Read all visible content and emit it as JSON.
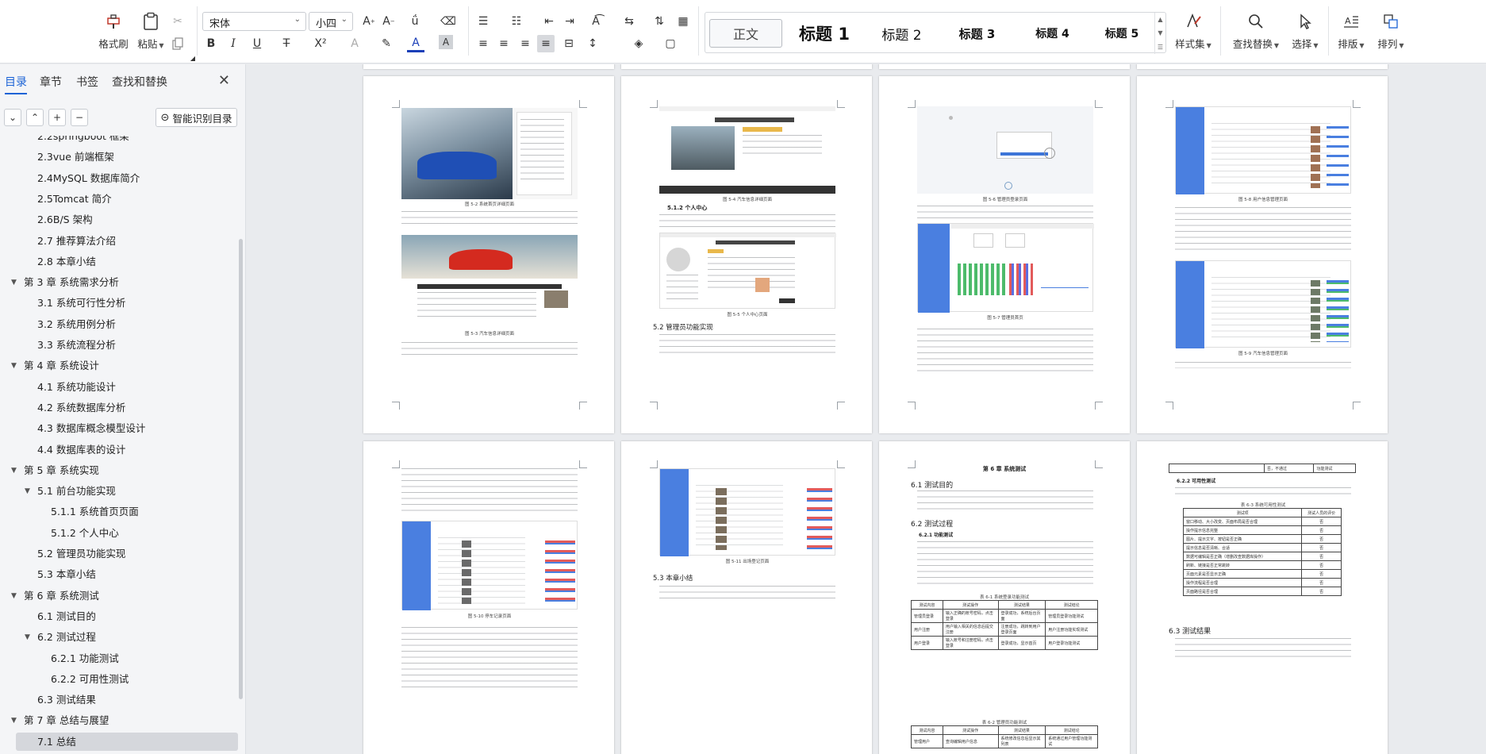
{
  "ribbon": {
    "format_brush": "格式刷",
    "paste": "粘贴",
    "font_name": "宋体",
    "font_size": "小四",
    "styles": {
      "normal": "正文",
      "h1": "标题 1",
      "h2": "标题 2",
      "h3": "标题 3",
      "h4": "标题 4",
      "h5": "标题 5"
    },
    "style_set": "样式集",
    "find_replace": "查找替换",
    "select": "选择",
    "layout": "排版",
    "arrange": "排列"
  },
  "nav": {
    "tabs": [
      "目录",
      "章节",
      "书签",
      "查找和替换"
    ],
    "ai_toc": "智能识别目录",
    "toc": [
      {
        "label": "2.2springboot 框架",
        "level": 2
      },
      {
        "label": "2.3vue 前端框架",
        "level": 2
      },
      {
        "label": "2.4MySQL 数据库简介",
        "level": 2
      },
      {
        "label": "2.5Tomcat 简介",
        "level": 2
      },
      {
        "label": "2.6B/S 架构",
        "level": 2
      },
      {
        "label": "2.7 推荐算法介绍",
        "level": 2
      },
      {
        "label": "2.8 本章小结",
        "level": 2
      },
      {
        "label": "第 3 章  系统需求分析",
        "level": 1
      },
      {
        "label": "3.1 系统可行性分析",
        "level": 2
      },
      {
        "label": "3.2 系统用例分析",
        "level": 2
      },
      {
        "label": "3.3 系统流程分析",
        "level": 2
      },
      {
        "label": "第 4 章  系统设计",
        "level": 1
      },
      {
        "label": "4.1 系统功能设计",
        "level": 2
      },
      {
        "label": "4.2 系统数据库分析",
        "level": 2
      },
      {
        "label": "4.3 数据库概念模型设计",
        "level": 2
      },
      {
        "label": "4.4 数据库表的设计",
        "level": 2
      },
      {
        "label": "第 5 章  系统实现",
        "level": 1
      },
      {
        "label": "5.1 前台功能实现",
        "level": 2,
        "expandable": true
      },
      {
        "label": "5.1.1 系统首页页面",
        "level": 3
      },
      {
        "label": "5.1.2 个人中心",
        "level": 3
      },
      {
        "label": "5.2 管理员功能实现",
        "level": 2
      },
      {
        "label": "5.3 本章小结",
        "level": 2
      },
      {
        "label": "第 6 章  系统测试",
        "level": 1
      },
      {
        "label": "6.1 测试目的",
        "level": 2
      },
      {
        "label": "6.2 测试过程",
        "level": 2,
        "expandable": true
      },
      {
        "label": "6.2.1 功能测试",
        "level": 3
      },
      {
        "label": "6.2.2 可用性测试",
        "level": 3
      },
      {
        "label": "6.3 测试结果",
        "level": 2
      },
      {
        "label": "第 7 章  总结与展望",
        "level": 1
      },
      {
        "label": "7.1 总结",
        "level": 2,
        "selected": true
      }
    ]
  },
  "pages": {
    "p1": {
      "cap1": "图 5-2 系统首页详细页面",
      "cap2": "图 5-3 汽车信息详细页面"
    },
    "p2": {
      "cap1": "图 5-4 汽车信息详细页面",
      "heading1": "5.1.2 个人中心",
      "cap2": "图 5-5 个人中心页面",
      "heading2": "5.2 管理员功能实现"
    },
    "p3": {
      "cap1": "图 5-6 管理员登录页面",
      "cap2": "图 5-7 管理员首页"
    },
    "p4": {
      "cap1": "图 5-8 用户信息管理页面",
      "cap2": "图 5-9 汽车信息管理页面"
    },
    "p5": {
      "cap1": "图 5-10 停车记录页面"
    },
    "p6": {
      "cap1": "图 5-11 出场登记页面",
      "heading1": "5.3 本章小结"
    },
    "p7": {
      "chapter": "第 6 章  系统测试",
      "h61": "6.1 测试目的",
      "h62": "6.2 测试过程",
      "h621": "6.2.1 功能测试",
      "t1_caption": "表 6-1 系统登录功能测试",
      "t1_head": [
        "测试内容",
        "测试操作",
        "测试结果",
        "测试结论"
      ],
      "t1_rows": [
        [
          "管理员登录",
          "输入正确的账号密码，点击登录",
          "登录成功，系统后台页面",
          "管理员登录功能测试"
        ],
        [
          "用户注册",
          "用户输入相关的信息后提交注册",
          "注册成功，跳转到用户登录页面",
          "用户注册功能实现测试"
        ],
        [
          "用户登录",
          "输入账号和注册密码，点击登录",
          "登录成功，显示首页",
          "用户登录功能测试"
        ]
      ],
      "t2_caption": "表 6-2 管理员功能测试",
      "t2_head": [
        "测试内容",
        "测试操作",
        "测试结果",
        "测试结论"
      ],
      "t2_rows": [
        [
          "管理用户",
          "查询编辑用户信息",
          "系统修改信息后显示其列表",
          "系统通过用户管理功能测试"
        ]
      ]
    },
    "p8": {
      "top_cell": "否，不通过",
      "top_cell2": "功能测试",
      "h622": "6.2.2 可用性测试",
      "t3_caption": "表 6-3 系统可用性测试",
      "t3_head": [
        "测试项",
        "测试人员的评价"
      ],
      "t3_rows": [
        [
          "窗口移动、大小改变、页面布局是否合理",
          "否"
        ],
        [
          "操作提示信息完整",
          "否"
        ],
        [
          "图片、提示文字、按钮是否正确",
          "否"
        ],
        [
          "提示信息是否清晰、合适",
          "否"
        ],
        [
          "数据可编辑是否正确（增删改查数据库操作）",
          "否"
        ],
        [
          "刷新、链接是否正常跳转",
          "否"
        ],
        [
          "页面元素是否显示正确",
          "否"
        ],
        [
          "操作流程是否合理",
          "否"
        ],
        [
          "页面路径是否合理",
          "否"
        ]
      ],
      "h63": "6.3 测试结果"
    }
  },
  "colors": {
    "accent": "#1b63d6",
    "admin_sidebar": "#4a7fe0",
    "panel_bg": "#f4f5f7",
    "doc_bg": "#e9ebee"
  }
}
